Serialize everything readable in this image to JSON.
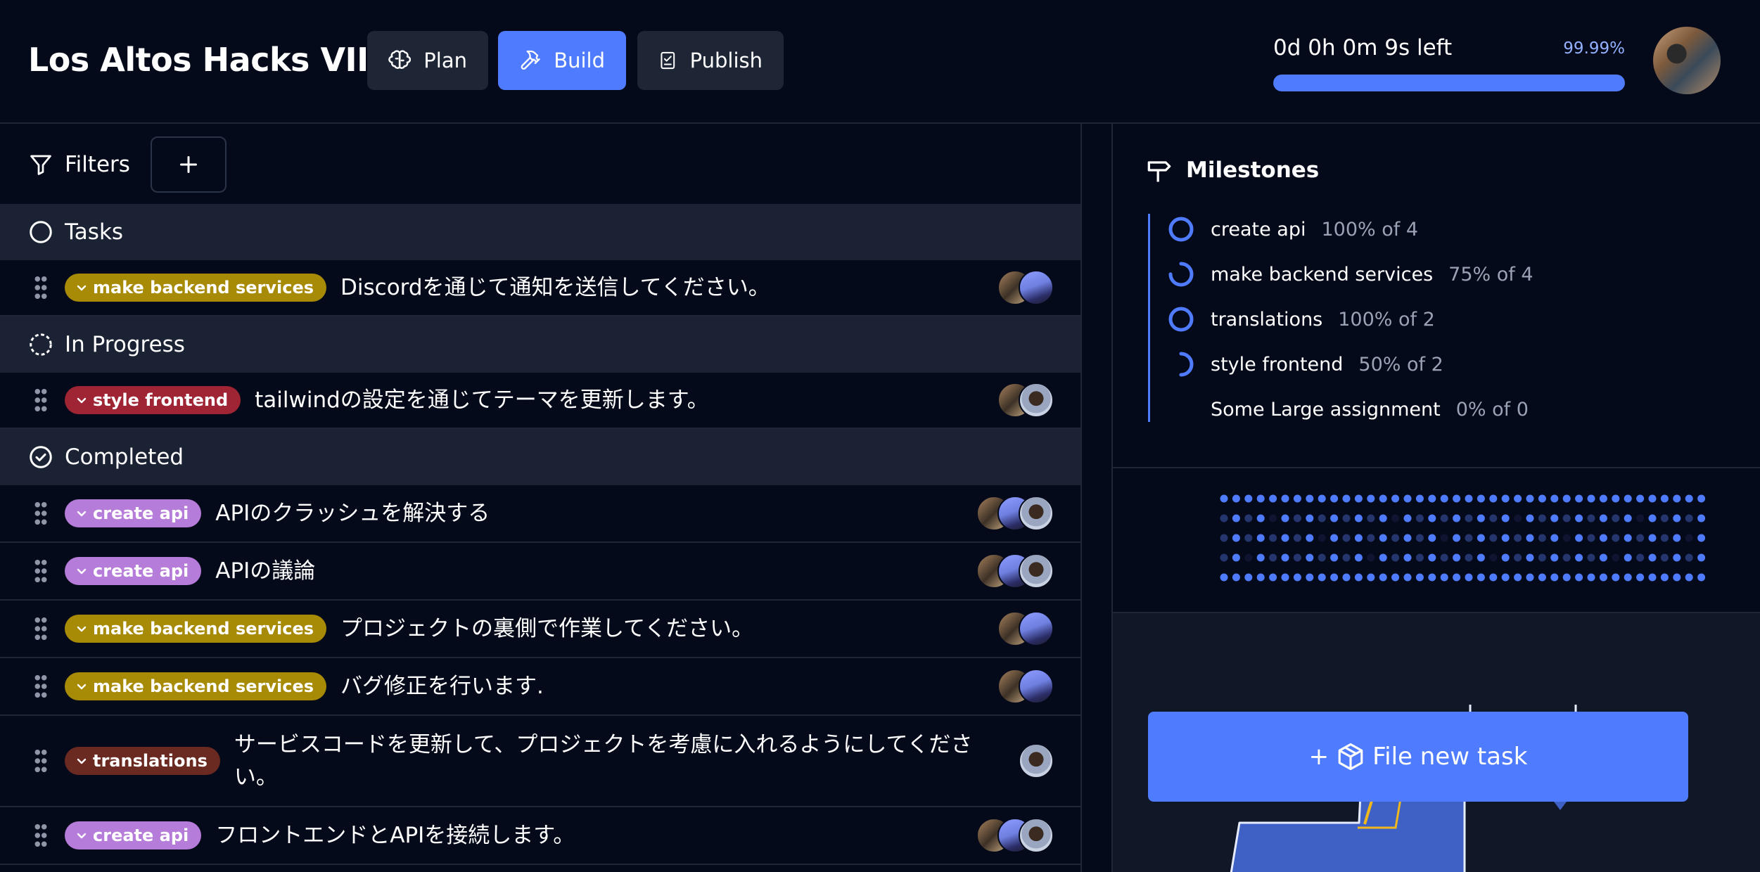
{
  "header": {
    "title": "Los Altos Hacks VIII",
    "nav": [
      {
        "label": "Plan",
        "icon": "brain-icon",
        "active": false
      },
      {
        "label": "Build",
        "icon": "hammer-icon",
        "active": true
      },
      {
        "label": "Publish",
        "icon": "checklist-icon",
        "active": false
      }
    ],
    "timer": {
      "text": "0d 0h 0m 9s left",
      "percent_label": "99.99%",
      "progress": 0.9999
    }
  },
  "toolbar": {
    "filters_label": "Filters",
    "add_icon": "plus-icon"
  },
  "groups": {
    "tasks": {
      "label": "Tasks",
      "icon": "circle-icon"
    },
    "in_progress": {
      "label": "In Progress",
      "icon": "dashed-circle-icon"
    },
    "completed": {
      "label": "Completed",
      "icon": "check-circle-icon"
    }
  },
  "tasks": [
    {
      "tag": "make backend services",
      "tag_color": "#a78a06",
      "text": "Discordを通じて通知を送信してください。",
      "avatars": [
        "a",
        "b"
      ]
    },
    {
      "tag": "style frontend",
      "tag_color": "#9f2534",
      "text": "tailwindの設定を通じてテーマを更新します。",
      "avatars": [
        "a",
        "c"
      ]
    },
    {
      "tag": "create api",
      "tag_color": "#b67cd9",
      "text": "APIのクラッシュを解決する",
      "avatars": [
        "a",
        "b",
        "c"
      ]
    },
    {
      "tag": "create api",
      "tag_color": "#b67cd9",
      "text": "APIの議論",
      "avatars": [
        "a",
        "b",
        "c"
      ]
    },
    {
      "tag": "make backend services",
      "tag_color": "#a78a06",
      "text": "プロジェクトの裏側で作業してください。",
      "avatars": [
        "a",
        "b"
      ]
    },
    {
      "tag": "make backend services",
      "tag_color": "#a78a06",
      "text": "バグ修正を行います.",
      "avatars": [
        "a",
        "b"
      ]
    },
    {
      "tag": "translations",
      "tag_color": "#6a2a22",
      "text": "サービスコードを更新して、プロジェクトを考慮に入れるようにしてください。",
      "avatars": [
        "c"
      ]
    },
    {
      "tag": "create api",
      "tag_color": "#b67cd9",
      "text": "フロントエンドとAPIを接続します。",
      "avatars": [
        "a",
        "b",
        "c"
      ]
    }
  ],
  "milestones": {
    "title": "Milestones",
    "icon": "signpost-icon",
    "items": [
      {
        "name": "create api",
        "pct": "100% of 4",
        "progress": 1.0
      },
      {
        "name": "make backend services",
        "pct": "75% of 4",
        "progress": 0.75
      },
      {
        "name": "translations",
        "pct": "100% of 2",
        "progress": 1.0
      },
      {
        "name": "style frontend",
        "pct": "50% of 2",
        "progress": 0.5
      },
      {
        "name": "Some Large assignment",
        "pct": "0% of 0",
        "progress": 0
      }
    ]
  },
  "file_button": {
    "label": "File new task",
    "icon": "package-icon"
  },
  "colors": {
    "accent": "#4f7cff",
    "background": "#050a1a",
    "group_bg": "#1a2233"
  }
}
